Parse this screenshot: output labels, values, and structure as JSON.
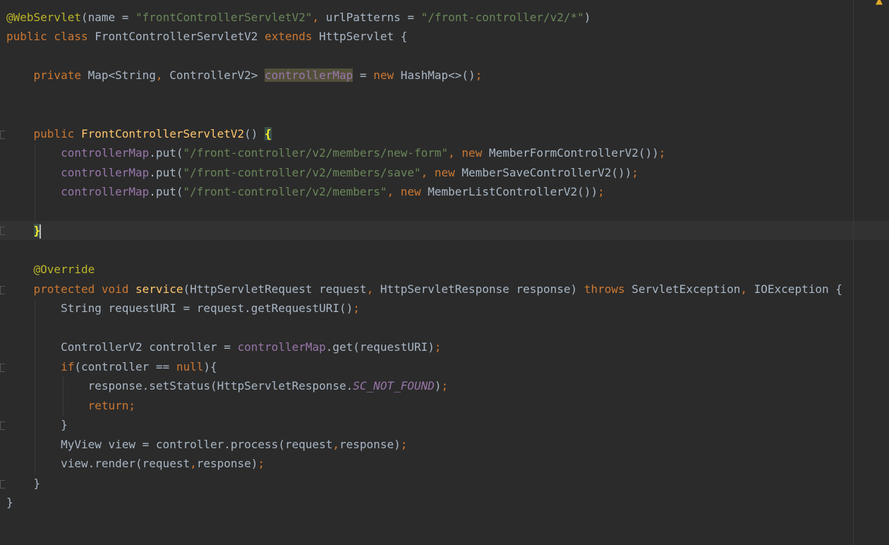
{
  "status": {
    "warning_icon": "warning-icon"
  },
  "code": {
    "l1": {
      "t1": "@WebServlet",
      "t2": "(name = ",
      "t3": "\"frontControllerServletV2\"",
      "t4": ", ",
      "t5": "urlPatterns = ",
      "t6": "\"/front-controller/v2/*\"",
      "t7": ")"
    },
    "l2": {
      "t1": "public class ",
      "t2": "FrontControllerServletV2 ",
      "t3": "extends ",
      "t4": "HttpServlet {"
    },
    "l3": {
      "t1": "private ",
      "t2": "Map<String",
      "t3": ", ",
      "t4": "ControllerV2> ",
      "t5": "controllerMap",
      "t6": " = ",
      "t7": "new ",
      "t8": "HashMap<>()",
      "t9": ";"
    },
    "l4": {
      "t1": "public ",
      "t2": "FrontControllerServletV2",
      "t3": "() ",
      "t4": "{"
    },
    "l5": {
      "t1": "controllerMap",
      "t2": ".put(",
      "t3": "\"/front-controller/v2/members/new-form\"",
      "t4": ", ",
      "t5": "new ",
      "t6": "MemberFormControllerV2())",
      "t7": ";"
    },
    "l6": {
      "t1": "controllerMap",
      "t2": ".put(",
      "t3": "\"/front-controller/v2/members/save\"",
      "t4": ", ",
      "t5": "new ",
      "t6": "MemberSaveControllerV2())",
      "t7": ";"
    },
    "l7": {
      "t1": "controllerMap",
      "t2": ".put(",
      "t3": "\"/front-controller/v2/members\"",
      "t4": ", ",
      "t5": "new ",
      "t6": "MemberListControllerV2())",
      "t7": ";"
    },
    "l8": {
      "t1": "}"
    },
    "l9": {
      "t1": "@Override"
    },
    "l10": {
      "t1": "protected void ",
      "t2": "service",
      "t3": "(HttpServletRequest request",
      "t4": ", ",
      "t5": "HttpServletResponse response) ",
      "t6": "throws ",
      "t7": "ServletException",
      "t8": ", ",
      "t9": "IOException {"
    },
    "l11": {
      "t1": "String requestURI = request.getRequestURI()",
      "t2": ";"
    },
    "l12": {
      "t1": "ControllerV2 controller = ",
      "t2": "controllerMap",
      "t3": ".get(requestURI)",
      "t4": ";"
    },
    "l13": {
      "t1": "if",
      "t2": "(controller == ",
      "t3": "null",
      "t4": "){"
    },
    "l14": {
      "t1": "response.setStatus(HttpServletResponse.",
      "t2": "SC_NOT_FOUND",
      "t3": ")",
      "t4": ";"
    },
    "l15": {
      "t1": "return;"
    },
    "l16": {
      "t1": "}"
    },
    "l17": {
      "t1": "MyView view = controller.process(request",
      "t2": ",",
      "t3": "response)",
      "t4": ";"
    },
    "l18": {
      "t1": "view.render(request",
      "t2": ",",
      "t3": "response)",
      "t4": ";"
    },
    "l19": {
      "t1": "}"
    },
    "l20": {
      "t1": "}"
    }
  }
}
